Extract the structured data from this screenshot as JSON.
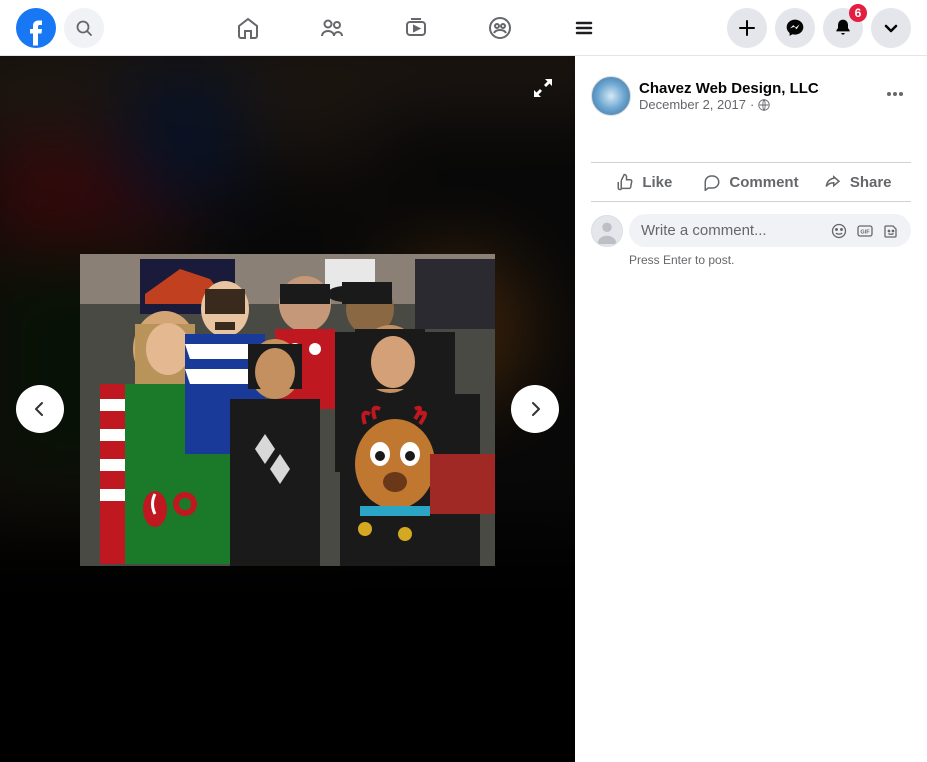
{
  "header": {
    "badge_count": "6"
  },
  "post": {
    "author": "Chavez Web Design, LLC",
    "date": "December 2, 2017",
    "separator": "·"
  },
  "actions": {
    "like": "Like",
    "comment": "Comment",
    "share": "Share"
  },
  "comment": {
    "placeholder": "Write a comment...",
    "hint": "Press Enter to post."
  }
}
